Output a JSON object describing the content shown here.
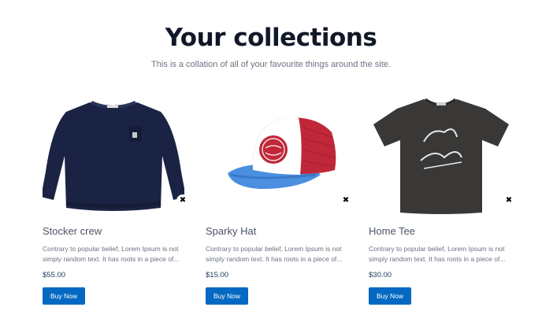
{
  "header": {
    "title": "Your collections",
    "subtitle": "This is a collation of all of your favourite things around the site."
  },
  "products": [
    {
      "name": "Stocker crew",
      "description": "Contrary to popular belief, Lorem Ipsum is not simply random text. It has roots in a piece of...",
      "price": "$55.00",
      "button_label": "Buy Now",
      "remove_glyph": "✖",
      "image": "navy-sweatshirt-image"
    },
    {
      "name": "Sparky Hat",
      "description": "Contrary to popular belief, Lorem Ipsum is not simply random text. It has roots in a piece of...",
      "price": "$15.00",
      "button_label": "Buy Now",
      "remove_glyph": "✖",
      "image": "trucker-hat-image"
    },
    {
      "name": "Home Tee",
      "description": "Contrary to popular belief, Lorem Ipsum is not simply random text. It has roots in a piece of...",
      "price": "$30.00",
      "button_label": "Buy Now",
      "remove_glyph": "✖",
      "image": "black-tshirt-image"
    }
  ],
  "colors": {
    "button": "#0369c2",
    "title": "#111827",
    "navy": "#1b2344",
    "hat_red": "#c0283a",
    "hat_blue": "#4a8fe0",
    "tee": "#3a3836"
  }
}
